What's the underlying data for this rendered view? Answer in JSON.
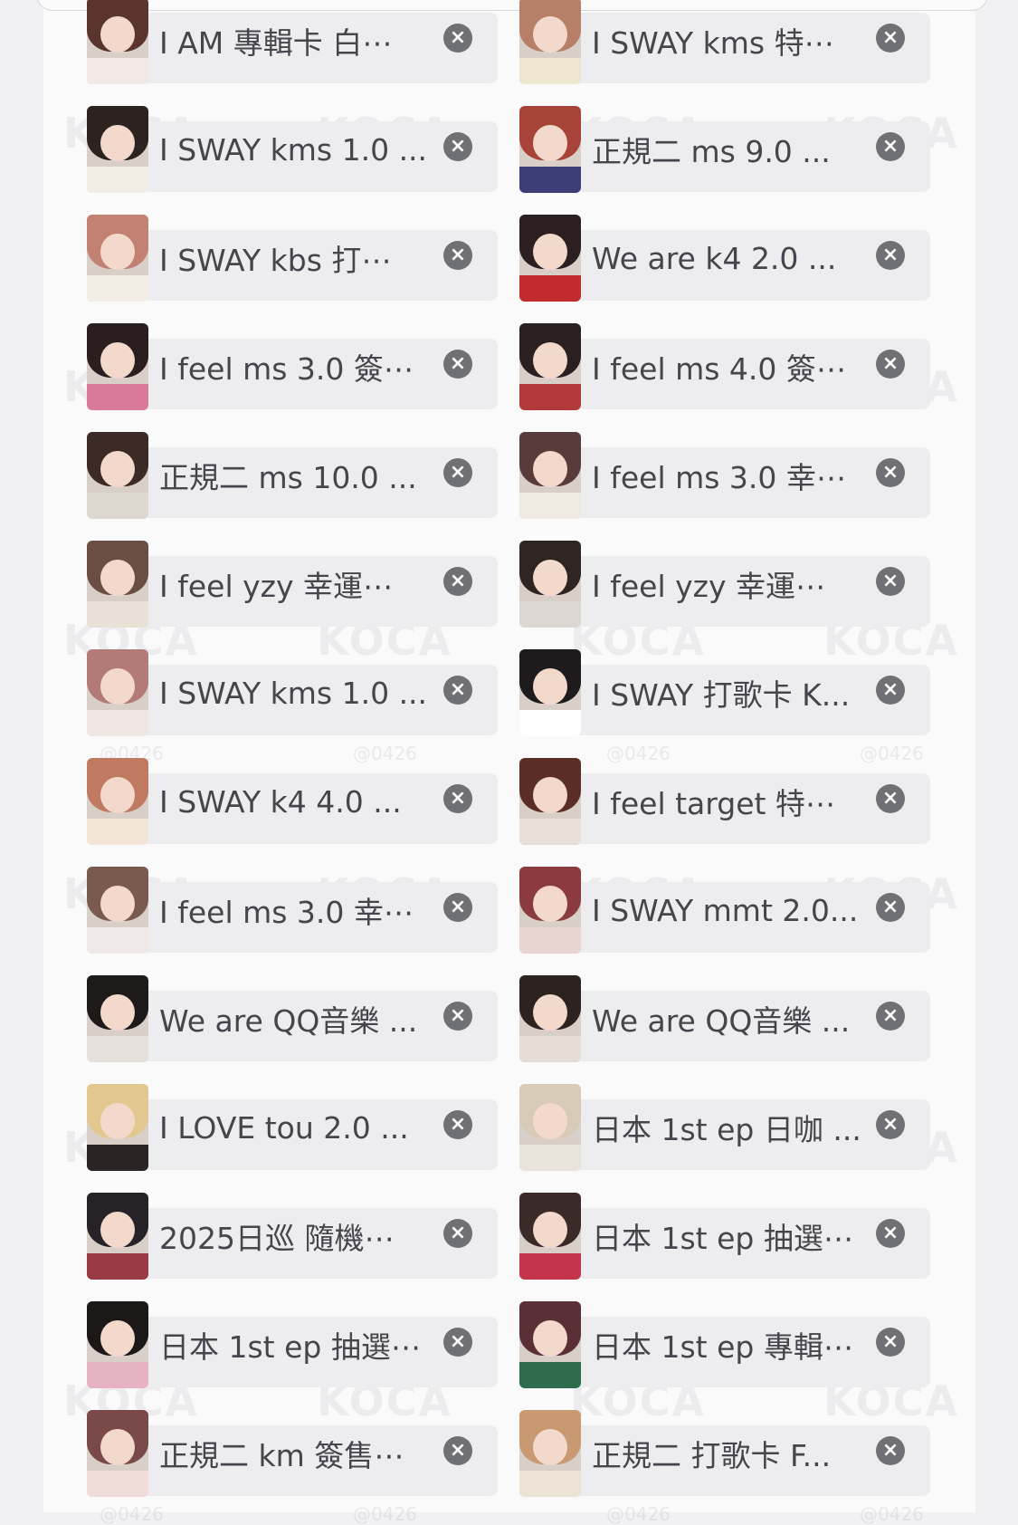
{
  "selected_items": [
    {
      "label": "I AM 專輯卡 白⋯",
      "thumb": {
        "hair": "#5a3530",
        "shirt": "#f2e9e6"
      }
    },
    {
      "label": "I SWAY kms 特⋯",
      "thumb": {
        "hair": "#b77f67",
        "shirt": "#efe6cf"
      }
    },
    {
      "label": "I SWAY kms 1.0 ...",
      "thumb": {
        "hair": "#2c2220",
        "shirt": "#f1ece4"
      }
    },
    {
      "label": "正規二 ms 9.0 ...",
      "thumb": {
        "hair": "#a74338",
        "shirt": "#3c3e7a"
      }
    },
    {
      "label": "I SWAY kbs 打⋯",
      "thumb": {
        "hair": "#c28172",
        "shirt": "#f4ede3"
      }
    },
    {
      "label": "We are k4 2.0 ...",
      "thumb": {
        "hair": "#2b201f",
        "shirt": "#c22b2c"
      }
    },
    {
      "label": "I feel ms 3.0 簽⋯",
      "thumb": {
        "hair": "#2a1e1f",
        "shirt": "#d97a9b"
      }
    },
    {
      "label": "I feel ms 4.0 簽⋯",
      "thumb": {
        "hair": "#2b2020",
        "shirt": "#b33a3a"
      }
    },
    {
      "label": "正規二 ms 10.0 ...",
      "thumb": {
        "hair": "#3b2a25",
        "shirt": "#ded7d0"
      }
    },
    {
      "label": "I feel ms 3.0 幸⋯",
      "thumb": {
        "hair": "#5a3b3b",
        "shirt": "#efe9e2"
      }
    },
    {
      "label": "I feel yzy 幸運⋯",
      "thumb": {
        "hair": "#6a4d44",
        "shirt": "#e9e1d6"
      }
    },
    {
      "label": "I feel yzy 幸運⋯",
      "thumb": {
        "hair": "#2e2523",
        "shirt": "#dcd7d0"
      }
    },
    {
      "label": "I SWAY kms 1.0 ...",
      "thumb": {
        "hair": "#b27b78",
        "shirt": "#f0e7e2"
      }
    },
    {
      "label": "I SWAY 打歌卡 K...",
      "thumb": {
        "hair": "#1f1a1c",
        "shirt": "#ffffff"
      }
    },
    {
      "label": "I SWAY k4 4.0 ...",
      "thumb": {
        "hair": "#c17a62",
        "shirt": "#f3e4d8"
      }
    },
    {
      "label": "I feel target 特⋯",
      "thumb": {
        "hair": "#5a2e27",
        "shirt": "#e8dfd6"
      }
    },
    {
      "label": "I feel ms 3.0 幸⋯",
      "thumb": {
        "hair": "#7a5a4e",
        "shirt": "#efe8e6"
      }
    },
    {
      "label": "I SWAY mmt 2.0...",
      "thumb": {
        "hair": "#8b3a3f",
        "shirt": "#e8d4d0"
      }
    },
    {
      "label": "We are QQ音樂 ...",
      "thumb": {
        "hair": "#1e1a1a",
        "shirt": "#e6e0da"
      }
    },
    {
      "label": "We are QQ音樂 ...",
      "thumb": {
        "hair": "#2c2321",
        "shirt": "#e5ddd5"
      }
    },
    {
      "label": "I LOVE tou 2.0 ...",
      "thumb": {
        "hair": "#e2c88f",
        "shirt": "#2a2424"
      }
    },
    {
      "label": "日本 1st ep 日咖 ...",
      "thumb": {
        "hair": "#d8cbb6",
        "shirt": "#e9e3dc"
      }
    },
    {
      "label": "2025日巡 隨機⋯",
      "thumb": {
        "hair": "#262228",
        "shirt": "#9a3a45"
      }
    },
    {
      "label": "日本 1st ep 抽選⋯",
      "thumb": {
        "hair": "#3a2a28",
        "shirt": "#c4344a"
      }
    },
    {
      "label": "日本 1st ep 抽選⋯",
      "thumb": {
        "hair": "#1c1818",
        "shirt": "#e7b3c3"
      }
    },
    {
      "label": "日本 1st ep 專輯⋯",
      "thumb": {
        "hair": "#5a2f36",
        "shirt": "#2e6b4a"
      }
    },
    {
      "label": "正規二 km 簽售⋯",
      "thumb": {
        "hair": "#7a4a4a",
        "shirt": "#f0dcd8"
      }
    },
    {
      "label": "正規二 打歌卡 F...",
      "thumb": {
        "hair": "#c99a72",
        "shirt": "#ece2d6"
      }
    }
  ],
  "watermark": {
    "brand": "KOCA",
    "handle": "@0426"
  },
  "icons": {
    "remove": "close-icon"
  },
  "remove_glyph": "×"
}
